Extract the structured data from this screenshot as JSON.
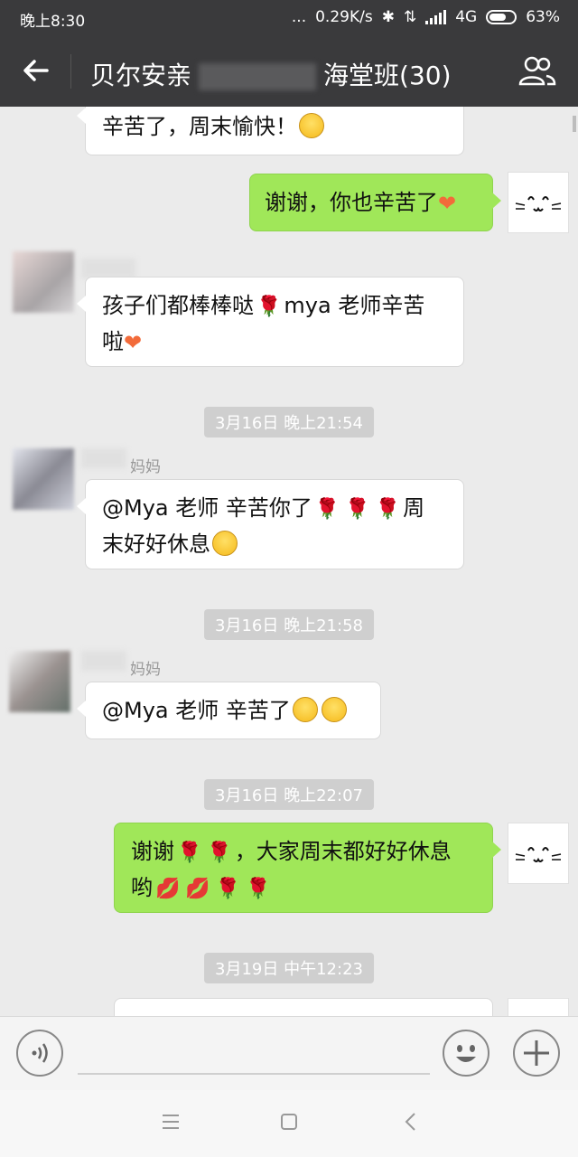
{
  "status_bar": {
    "time": "晚上8:30",
    "dots": "...",
    "speed": "0.29K/s",
    "network": "4G",
    "battery": "63%"
  },
  "header": {
    "title_prefix": "贝尔安亲",
    "title_suffix": "海堂班(30)"
  },
  "messages": [
    {
      "side": "left",
      "text": "辛苦了，周末愉快！"
    },
    {
      "side": "right",
      "text": "谢谢，你也辛苦了"
    },
    {
      "side": "left",
      "text_1": "孩子们都棒棒哒",
      "text_2": "mya 老师辛苦",
      "text_3": "啦"
    },
    {
      "type": "time",
      "text": "3月16日 晚上21:54"
    },
    {
      "side": "left",
      "sender": "妈妈",
      "text_1": "@Mya 老师  辛苦你了",
      "text_2": "周",
      "text_3": "末好好休息"
    },
    {
      "type": "time",
      "text": "3月16日 晚上21:58"
    },
    {
      "side": "left",
      "sender": "妈妈",
      "text": "@Mya 老师  辛苦了"
    },
    {
      "type": "time",
      "text": "3月16日 晚上22:07"
    },
    {
      "side": "right",
      "text_1": "谢谢",
      "text_2": "，大家周末都好好休息",
      "text_3": "哟"
    },
    {
      "type": "time",
      "text": "3月19日 中午12:23"
    }
  ],
  "icons": {
    "back": "arrow-left-icon",
    "group": "group-members-icon",
    "voice": "voice-icon",
    "emoji": "emoji-icon",
    "plus": "plus-icon"
  }
}
